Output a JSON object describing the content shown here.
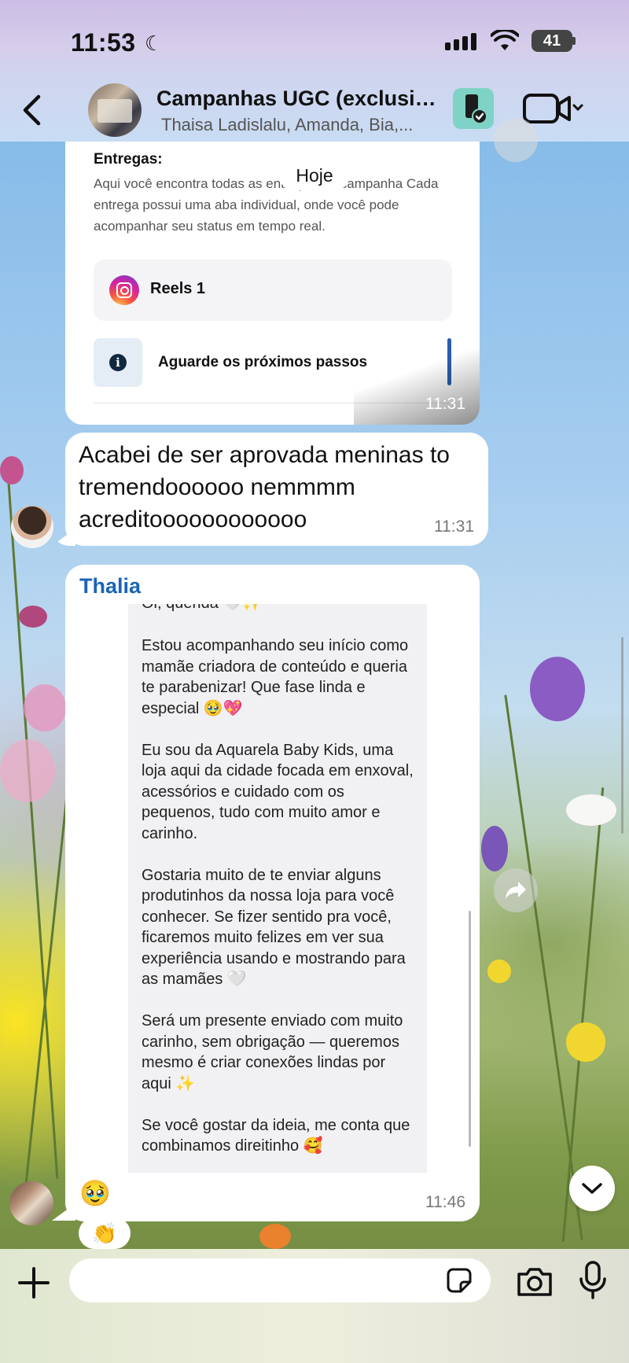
{
  "status_bar": {
    "time": "11:53",
    "battery": "41"
  },
  "header": {
    "title": "Campanhas UGC (exclusiv...",
    "subtitle": "Thaisa Ladislalu, Amanda, Bia,..."
  },
  "date_divider": "Hoje",
  "card_message": {
    "section_title": "Entregas:",
    "description": "Aqui você encontra todas as entregas da campanha Cada entrega possui uma aba individual, onde você pode acompanhar seu status em tempo real.",
    "reels_label": "Reels 1",
    "next_steps_label": "Aguarde os próximos passos",
    "time": "11:31"
  },
  "text_message": {
    "text": "Acabei de ser aprovada meninas to tremendoooooo nemmmm acreditoooooooooooo",
    "time": "11:31"
  },
  "quoted_message": {
    "sender": "Thalia",
    "clipped_top_line": "Oi, querida 🤍✨",
    "body": "Estou acompanhando seu início como mamãe criadora de conteúdo e queria te parabenizar! Que fase linda e especial 🥹💖\n\nEu sou da Aquarela Baby Kids, uma loja aqui da cidade focada em enxoval, acessórios e cuidado com os pequenos, tudo com muito amor e carinho.\n\nGostaria muito de te enviar alguns produtinhos da nossa loja para você conhecer. Se fizer sentido pra você, ficaremos muito felizes em ver sua experiência usando e mostrando para as mamães 🤍\n\nSerá um presente enviado com muito carinho, sem obrigação — queremos mesmo é criar conexões lindas por aqui ✨\n\nSe você gostar da ideia, me conta que combinamos direitinho 🥰",
    "emoji": "🥹",
    "time": "11:46",
    "reaction": "👏"
  },
  "composer": {
    "placeholder": ""
  },
  "colors": {
    "sender_name": "#1a64b8",
    "progress_bar": "#2a5eab",
    "device_badge": "#7fd3c6"
  },
  "icons": [
    "back-icon",
    "device-icon",
    "video-call-icon",
    "instagram-icon",
    "info-icon",
    "forward-icon",
    "chevron-down-icon",
    "plus-icon",
    "sticker-icon",
    "camera-icon",
    "microphone-icon"
  ]
}
